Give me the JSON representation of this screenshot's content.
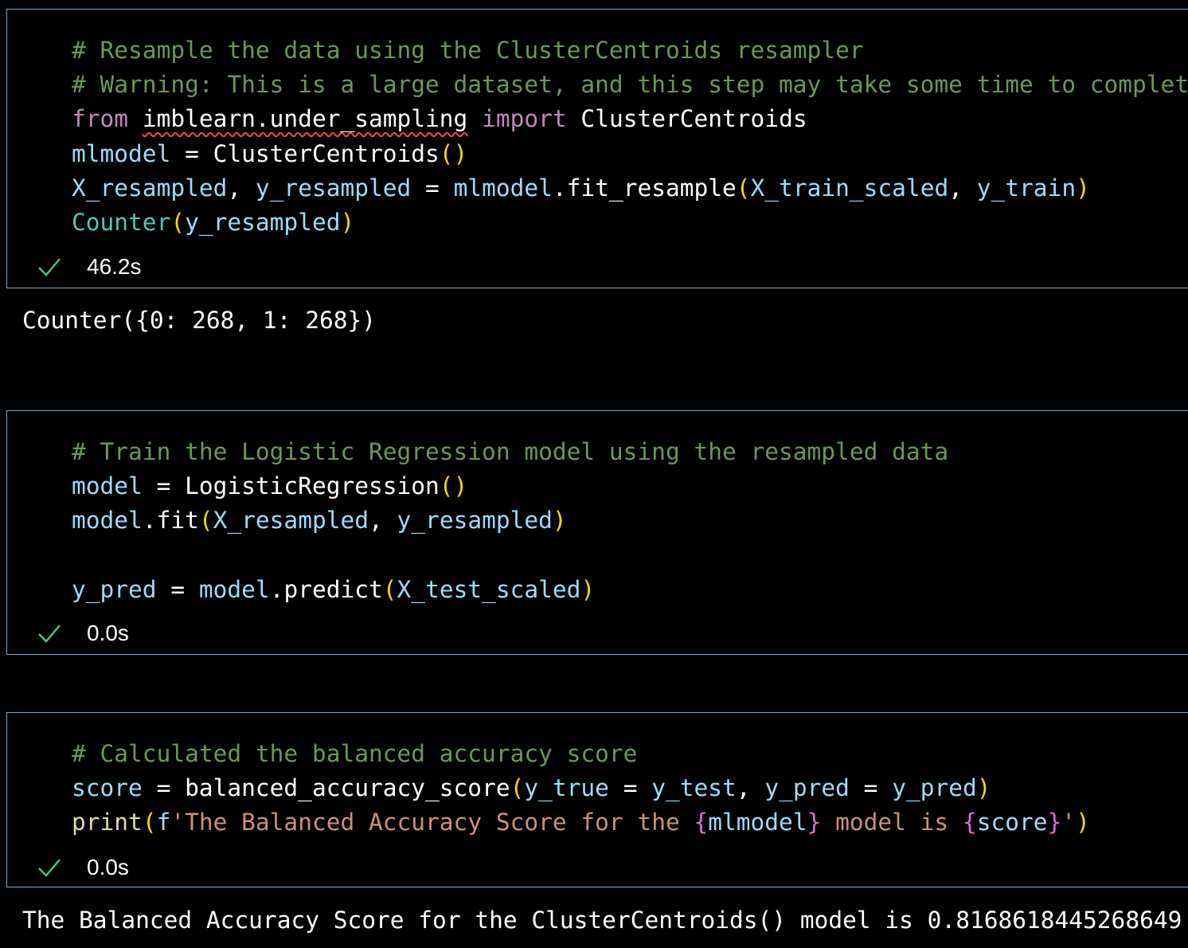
{
  "colors": {
    "background": "#000000",
    "cell_border": "#7fa8c4",
    "comment": "#6a9955",
    "keyword": "#c586c0",
    "variable": "#9cdcfe",
    "function": "#dcdcaa",
    "class": "#4ec9b0",
    "string": "#ce9178",
    "bracket_level1": "#ffd700",
    "bracket_level2": "#da70d6",
    "success_check": "#4ec27a",
    "error_squiggle": "#f14c4c"
  },
  "cells": [
    {
      "status_icon": "check-icon",
      "exec_time": "46.2s",
      "output": "Counter({0: 268, 1: 268})",
      "lines": [
        [
          {
            "t": "cm",
            "v": "# Resample the data using the ClusterCentroids resampler"
          }
        ],
        [
          {
            "t": "cm",
            "v": "# Warning: This is a large dataset, and this step may take some time to complete"
          }
        ],
        [
          {
            "t": "kw",
            "v": "from"
          },
          {
            "t": "pl",
            "v": " "
          },
          {
            "t": "pl",
            "v": "imblearn.under_sampling",
            "squiggle": true
          },
          {
            "t": "pl",
            "v": " "
          },
          {
            "t": "kw",
            "v": "import"
          },
          {
            "t": "pl",
            "v": " ClusterCentroids"
          }
        ],
        [
          {
            "t": "vr",
            "v": "mlmodel"
          },
          {
            "t": "pl",
            "v": " = "
          },
          {
            "t": "pl",
            "v": "ClusterCentroids"
          },
          {
            "t": "p1",
            "v": "()"
          }
        ],
        [
          {
            "t": "vr",
            "v": "X_resampled"
          },
          {
            "t": "pl",
            "v": ", "
          },
          {
            "t": "vr",
            "v": "y_resampled"
          },
          {
            "t": "pl",
            "v": " = "
          },
          {
            "t": "vr",
            "v": "mlmodel"
          },
          {
            "t": "pl",
            "v": ".fit_resample"
          },
          {
            "t": "p1",
            "v": "("
          },
          {
            "t": "vr",
            "v": "X_train_scaled"
          },
          {
            "t": "pl",
            "v": ", "
          },
          {
            "t": "vr",
            "v": "y_train"
          },
          {
            "t": "p1",
            "v": ")"
          }
        ],
        [
          {
            "t": "cl",
            "v": "Counter"
          },
          {
            "t": "p1",
            "v": "("
          },
          {
            "t": "vr",
            "v": "y_resampled"
          },
          {
            "t": "p1",
            "v": ")"
          }
        ]
      ]
    },
    {
      "status_icon": "check-icon",
      "exec_time": "0.0s",
      "output": "",
      "lines": [
        [
          {
            "t": "cm",
            "v": "# Train the Logistic Regression model using the resampled data"
          }
        ],
        [
          {
            "t": "vr",
            "v": "model"
          },
          {
            "t": "pl",
            "v": " = LogisticRegression"
          },
          {
            "t": "p1",
            "v": "()"
          }
        ],
        [
          {
            "t": "vr",
            "v": "model"
          },
          {
            "t": "pl",
            "v": ".fit"
          },
          {
            "t": "p1",
            "v": "("
          },
          {
            "t": "vr",
            "v": "X_resampled"
          },
          {
            "t": "pl",
            "v": ", "
          },
          {
            "t": "vr",
            "v": "y_resampled"
          },
          {
            "t": "p1",
            "v": ")"
          }
        ],
        [],
        [
          {
            "t": "vr",
            "v": "y_pred"
          },
          {
            "t": "pl",
            "v": " = "
          },
          {
            "t": "vr",
            "v": "model"
          },
          {
            "t": "pl",
            "v": ".predict"
          },
          {
            "t": "p1",
            "v": "("
          },
          {
            "t": "vr",
            "v": "X_test_scaled"
          },
          {
            "t": "p1",
            "v": ")"
          }
        ]
      ]
    },
    {
      "status_icon": "check-icon",
      "exec_time": "0.0s",
      "output": "The Balanced Accuracy Score for the ClusterCentroids() model is 0.8168618445268649",
      "lines": [
        [
          {
            "t": "cm",
            "v": "# Calculated the balanced accuracy score"
          }
        ],
        [
          {
            "t": "vr",
            "v": "score"
          },
          {
            "t": "pl",
            "v": " = balanced_accuracy_score"
          },
          {
            "t": "p1",
            "v": "("
          },
          {
            "t": "vr",
            "v": "y_true"
          },
          {
            "t": "pl",
            "v": " = "
          },
          {
            "t": "vr",
            "v": "y_test"
          },
          {
            "t": "pl",
            "v": ", "
          },
          {
            "t": "vr",
            "v": "y_pred"
          },
          {
            "t": "pl",
            "v": " = "
          },
          {
            "t": "vr",
            "v": "y_pred"
          },
          {
            "t": "p1",
            "v": ")"
          }
        ],
        [
          {
            "t": "fn",
            "v": "print"
          },
          {
            "t": "p1",
            "v": "("
          },
          {
            "t": "vr",
            "v": "f"
          },
          {
            "t": "st",
            "v": "'The Balanced Accuracy Score for the "
          },
          {
            "t": "p2",
            "v": "{"
          },
          {
            "t": "vr",
            "v": "mlmodel"
          },
          {
            "t": "p2",
            "v": "}"
          },
          {
            "t": "st",
            "v": " model is "
          },
          {
            "t": "p2",
            "v": "{"
          },
          {
            "t": "vr",
            "v": "score"
          },
          {
            "t": "p2",
            "v": "}"
          },
          {
            "t": "st",
            "v": "'"
          },
          {
            "t": "p1",
            "v": ")"
          }
        ]
      ]
    }
  ]
}
